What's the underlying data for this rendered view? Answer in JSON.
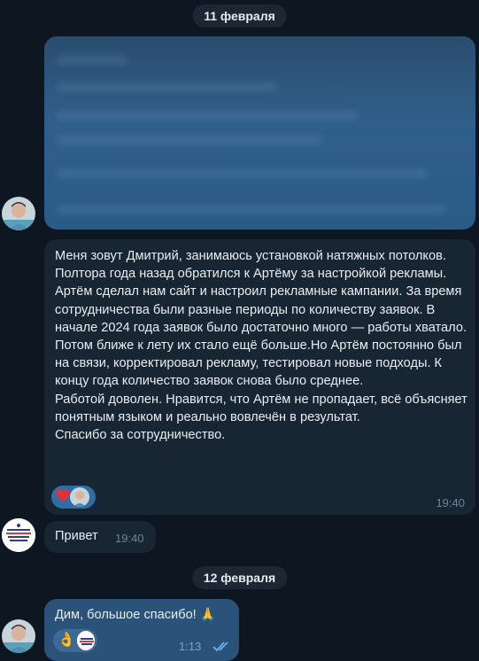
{
  "chat": {
    "date_1": "11 февраля",
    "date_2": "12 февраля",
    "messages": [
      {
        "text": "Меня зовут Дмитрий, занимаюсь установкой натяжных потолков. Полтора года назад обратился к Артёму за настройкой рекламы.\nАртём сделал нам сайт и настроил рекламные кампании. За время сотрудничества были разные периоды по количеству заявок. В начале 2024 года заявок было достаточно много — работы хватало. Потом ближе к лету их стало ещё больше.Но Артём постоянно был на связи, корректировал рекламу, тестировал новые подходы. К концу года количество заявок снова было среднее.\nРаботой доволен. Нравится, что Артём не пропадает, всё объясняет понятным языком и реально вовлечён в результат.\nСпасибо за сотрудничество.",
        "time": "19:40",
        "reaction": "heart-icon"
      },
      {
        "text": "Привет",
        "time": "19:40"
      },
      {
        "text": "Дим, большое спасибо! 🙏",
        "time": "1:13",
        "reaction": "ok-hand-icon",
        "read": "double-check-icon"
      }
    ]
  }
}
